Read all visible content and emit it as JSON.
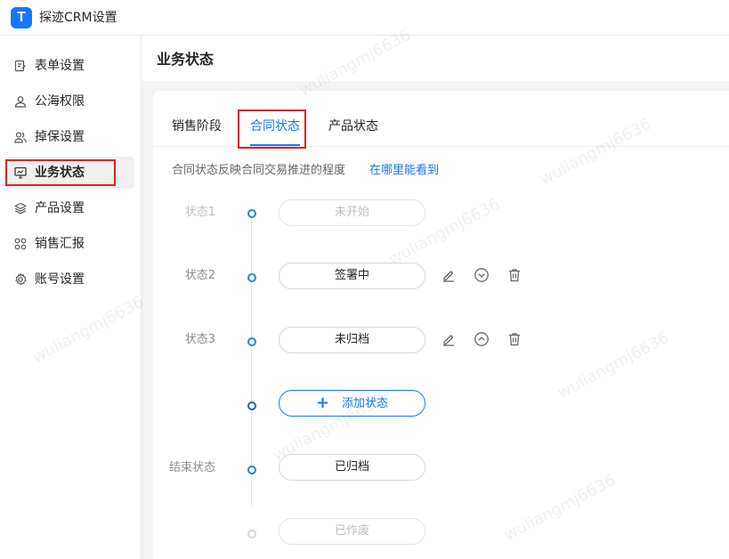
{
  "window": {
    "logo_glyph": "T",
    "title": "探迹CRM设置"
  },
  "sidebar": {
    "items": [
      {
        "label": "表单设置",
        "icon": "form-edit-icon"
      },
      {
        "label": "公海权限",
        "icon": "user-icon"
      },
      {
        "label": "掉保设置",
        "icon": "users-icon"
      },
      {
        "label": "业务状态",
        "icon": "monitor-icon",
        "active": true
      },
      {
        "label": "产品设置",
        "icon": "layers-icon"
      },
      {
        "label": "销售汇报",
        "icon": "grid-icon"
      },
      {
        "label": "账号设置",
        "icon": "gear-icon"
      }
    ]
  },
  "page": {
    "title": "业务状态"
  },
  "tabs": [
    {
      "label": "销售阶段"
    },
    {
      "label": "合同状态",
      "active": true
    },
    {
      "label": "产品状态"
    }
  ],
  "description": {
    "text": "合同状态反映合同交易推进的程度",
    "link": "在哪里能看到"
  },
  "statuses": [
    {
      "label": "状态1",
      "value": "未开始",
      "disabled": true
    },
    {
      "label": "状态2",
      "value": "签署中"
    },
    {
      "label": "状态3",
      "value": "未归档"
    },
    {
      "label": "",
      "value": "添加状态",
      "add": true
    },
    {
      "label": "结束状态",
      "value": "已归档"
    },
    {
      "label": "",
      "value": "已作废",
      "disabled": true
    }
  ],
  "watermark": "wuliangmj6636",
  "colors": {
    "accent": "#1677ff",
    "highlight_box": "#e02020",
    "active_bg": "#f0f0f0"
  }
}
